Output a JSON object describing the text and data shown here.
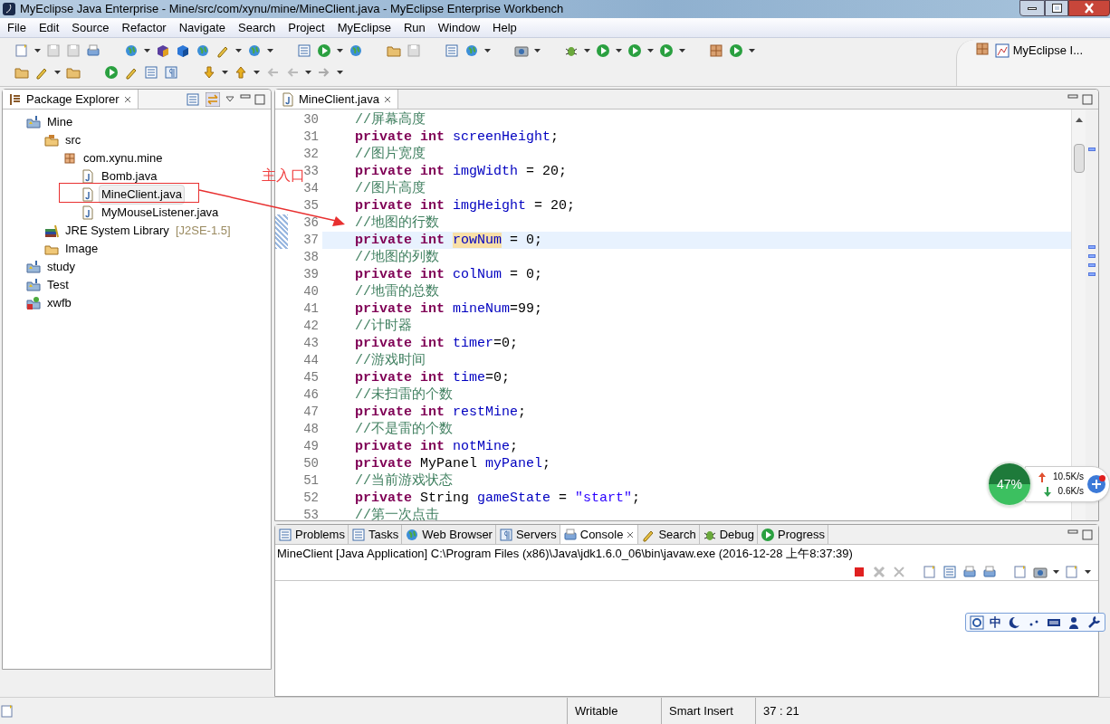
{
  "window": {
    "title": "MyEclipse Java Enterprise - Mine/src/com/xynu/mine/MineClient.java - MyEclipse Enterprise Workbench"
  },
  "menu": [
    "File",
    "Edit",
    "Source",
    "Refactor",
    "Navigate",
    "Search",
    "Project",
    "MyEclipse",
    "Run",
    "Window",
    "Help"
  ],
  "perspective": {
    "label": "MyEclipse I..."
  },
  "package_explorer": {
    "title": "Package Explorer",
    "tree": [
      {
        "label": "Mine",
        "kind": "project",
        "selected": false,
        "children": [
          {
            "label": "src",
            "kind": "source_folder",
            "selected": false,
            "children": [
              {
                "label": "com.xynu.mine",
                "kind": "package",
                "selected": false,
                "children": [
                  {
                    "label": "Bomb.java",
                    "kind": "java",
                    "selected": false
                  },
                  {
                    "label": "MineClient.java",
                    "kind": "java",
                    "selected": true
                  },
                  {
                    "label": "MyMouseListener.java",
                    "kind": "java",
                    "selected": false
                  }
                ]
              }
            ]
          },
          {
            "label": "JRE System Library",
            "suffix": "[J2SE-1.5]",
            "kind": "library",
            "selected": false
          },
          {
            "label": "Image",
            "kind": "folder",
            "selected": false
          }
        ]
      },
      {
        "label": "study",
        "kind": "project",
        "selected": false
      },
      {
        "label": "Test",
        "kind": "project",
        "selected": false
      },
      {
        "label": "xwfb",
        "kind": "project_error",
        "selected": false
      }
    ]
  },
  "annotation": {
    "label": "主入口"
  },
  "editor": {
    "tab": {
      "label": "MineClient.java",
      "selected": true
    },
    "lines": [
      {
        "number": "30",
        "selected": false,
        "tokens": [
          {
            "kind": "comment",
            "text": "//屏幕高度"
          }
        ]
      },
      {
        "number": "31",
        "selected": false,
        "tokens": [
          {
            "kind": "keyword",
            "text": "private int "
          },
          {
            "kind": "field",
            "text": "screenHeight"
          },
          {
            "kind": "plain",
            "text": ";"
          }
        ]
      },
      {
        "number": "32",
        "selected": false,
        "tokens": [
          {
            "kind": "comment",
            "text": "//图片宽度"
          }
        ]
      },
      {
        "number": "33",
        "selected": false,
        "tokens": [
          {
            "kind": "keyword",
            "text": "private int "
          },
          {
            "kind": "field",
            "text": "imgWidth"
          },
          {
            "kind": "plain",
            "text": " = 20;"
          }
        ]
      },
      {
        "number": "34",
        "selected": false,
        "tokens": [
          {
            "kind": "comment",
            "text": "//图片高度"
          }
        ]
      },
      {
        "number": "35",
        "selected": false,
        "tokens": [
          {
            "kind": "keyword",
            "text": "private int "
          },
          {
            "kind": "field",
            "text": "imgHeight"
          },
          {
            "kind": "plain",
            "text": " = 20;"
          }
        ]
      },
      {
        "number": "36",
        "selected": false,
        "tokens": [
          {
            "kind": "comment",
            "text": "//地图的行数"
          }
        ]
      },
      {
        "number": "37",
        "selected": true,
        "tokens": [
          {
            "kind": "keyword",
            "text": "private int "
          },
          {
            "kind": "field_marked",
            "text": "rowNum"
          },
          {
            "kind": "plain",
            "text": " = 0;"
          }
        ]
      },
      {
        "number": "38",
        "selected": false,
        "tokens": [
          {
            "kind": "comment",
            "text": "//地图的列数"
          }
        ]
      },
      {
        "number": "39",
        "selected": false,
        "tokens": [
          {
            "kind": "keyword",
            "text": "private int "
          },
          {
            "kind": "field",
            "text": "colNum"
          },
          {
            "kind": "plain",
            "text": " = 0;"
          }
        ]
      },
      {
        "number": "40",
        "selected": false,
        "tokens": [
          {
            "kind": "comment",
            "text": "//地雷的总数"
          }
        ]
      },
      {
        "number": "41",
        "selected": false,
        "tokens": [
          {
            "kind": "keyword",
            "text": "private int "
          },
          {
            "kind": "field",
            "text": "mineNum"
          },
          {
            "kind": "plain",
            "text": "=99;"
          }
        ]
      },
      {
        "number": "42",
        "selected": false,
        "tokens": [
          {
            "kind": "comment",
            "text": "//计时器"
          }
        ]
      },
      {
        "number": "43",
        "selected": false,
        "tokens": [
          {
            "kind": "keyword",
            "text": "private int "
          },
          {
            "kind": "field",
            "text": "timer"
          },
          {
            "kind": "plain",
            "text": "=0;"
          }
        ]
      },
      {
        "number": "44",
        "selected": false,
        "tokens": [
          {
            "kind": "comment",
            "text": "//游戏时间"
          }
        ]
      },
      {
        "number": "45",
        "selected": false,
        "tokens": [
          {
            "kind": "keyword",
            "text": "private int "
          },
          {
            "kind": "field",
            "text": "time"
          },
          {
            "kind": "plain",
            "text": "=0;"
          }
        ]
      },
      {
        "number": "46",
        "selected": false,
        "tokens": [
          {
            "kind": "comment",
            "text": "//未扫雷的个数"
          }
        ]
      },
      {
        "number": "47",
        "selected": false,
        "tokens": [
          {
            "kind": "keyword",
            "text": "private int "
          },
          {
            "kind": "field",
            "text": "restMine"
          },
          {
            "kind": "plain",
            "text": ";"
          }
        ]
      },
      {
        "number": "48",
        "selected": false,
        "tokens": [
          {
            "kind": "comment",
            "text": "//不是雷的个数"
          }
        ]
      },
      {
        "number": "49",
        "selected": false,
        "tokens": [
          {
            "kind": "keyword",
            "text": "private int "
          },
          {
            "kind": "field",
            "text": "notMine"
          },
          {
            "kind": "plain",
            "text": ";"
          }
        ]
      },
      {
        "number": "50",
        "selected": false,
        "tokens": [
          {
            "kind": "keyword",
            "text": "private "
          },
          {
            "kind": "plain",
            "text": "MyPanel "
          },
          {
            "kind": "field",
            "text": "myPanel"
          },
          {
            "kind": "plain",
            "text": ";"
          }
        ]
      },
      {
        "number": "51",
        "selected": false,
        "tokens": [
          {
            "kind": "comment",
            "text": "//当前游戏状态"
          }
        ]
      },
      {
        "number": "52",
        "selected": false,
        "tokens": [
          {
            "kind": "keyword",
            "text": "private "
          },
          {
            "kind": "plain",
            "text": "String "
          },
          {
            "kind": "field",
            "text": "gameState"
          },
          {
            "kind": "plain",
            "text": " = "
          },
          {
            "kind": "string",
            "text": "\"start\""
          },
          {
            "kind": "plain",
            "text": ";"
          }
        ]
      },
      {
        "number": "53",
        "selected": false,
        "tokens": [
          {
            "kind": "comment",
            "text": "//第一次点击"
          }
        ]
      }
    ]
  },
  "net_monitor": {
    "percent": "47%",
    "upload": "10.5K/s",
    "download": "0.6K/s"
  },
  "console": {
    "tabs": [
      {
        "label": "Problems",
        "selected": false
      },
      {
        "label": "Tasks",
        "selected": false
      },
      {
        "label": "Web Browser",
        "selected": false
      },
      {
        "label": "Servers",
        "selected": false
      },
      {
        "label": "Console",
        "selected": true
      },
      {
        "label": "Search",
        "selected": false
      },
      {
        "label": "Debug",
        "selected": false
      },
      {
        "label": "Progress",
        "selected": false
      }
    ],
    "process": "MineClient [Java Application] C:\\Program Files (x86)\\Java\\jdk1.6.0_06\\bin\\javaw.exe (2016-12-28 上午8:37:39)"
  },
  "ime": {
    "label": "中"
  },
  "status_bar": {
    "items": [
      "Writable",
      "Smart Insert",
      "37 : 21"
    ]
  }
}
